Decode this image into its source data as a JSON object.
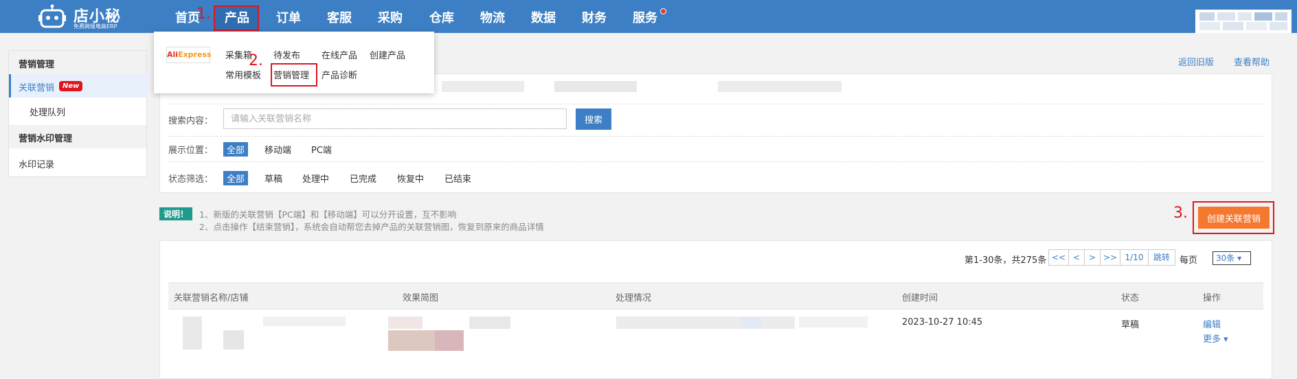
{
  "header": {
    "brand_name": "店小秘",
    "slogan": "免费跨境电商ERP",
    "nav": [
      {
        "label": "首页"
      },
      {
        "label": "产品"
      },
      {
        "label": "订单"
      },
      {
        "label": "客服"
      },
      {
        "label": "采购"
      },
      {
        "label": "仓库"
      },
      {
        "label": "物流"
      },
      {
        "label": "数据"
      },
      {
        "label": "财务"
      },
      {
        "label": "服务"
      }
    ],
    "active_nav": "产品"
  },
  "annotations": {
    "step1": "1.",
    "step2": "2.",
    "step3": "3."
  },
  "product_menu": {
    "platform_logo_left": "Ali",
    "platform_logo_right": "Express",
    "items": [
      "采集箱",
      "待发布",
      "在线产品",
      "创建产品",
      "常用模板",
      "营销管理",
      "产品诊断"
    ]
  },
  "sidebar": {
    "sections": [
      {
        "title": "营销管理",
        "items": [
          {
            "label": "关联营销",
            "badge": "New"
          },
          {
            "label": "处理队列"
          }
        ]
      },
      {
        "title": "营销水印管理",
        "items": [
          {
            "label": "水印记录"
          }
        ]
      }
    ]
  },
  "top_links": {
    "back_old": "返回旧版",
    "help": "查看帮助"
  },
  "filters": {
    "search_label": "搜索内容：",
    "search_placeholder": "请输入关联营销名称",
    "search_button": "搜索",
    "position_label": "展示位置：",
    "position_options": [
      "全部",
      "移动端",
      "PC端"
    ],
    "status_label": "状态筛选：",
    "status_options": [
      "全部",
      "草稿",
      "处理中",
      "已完成",
      "恢复中",
      "已结束"
    ]
  },
  "notice": {
    "badge": "说明！",
    "line1": "1、新版的关联营销【PC端】和【移动端】可以分开设置，互不影响",
    "line2": "2、点击操作【结束营销】，系统会自动帮您去掉产品的关联营销图，恢复到原来的商品详情"
  },
  "create_button": "创建关联营销",
  "pagination": {
    "summary": "第1-30条，共275条",
    "first": "<<",
    "prev": "<",
    "next": ">",
    "last": ">>",
    "page": "1/10",
    "jump": "跳转",
    "per_page_label": "每页",
    "per_page_value": "30条 ▾"
  },
  "table": {
    "columns": [
      "关联营销名称/店铺",
      "效果简图",
      "处理情况",
      "创建时间",
      "状态",
      "操作"
    ],
    "rows": [
      {
        "created": "2023-10-27 10:45",
        "status": "草稿",
        "edit": "编辑",
        "more": "更多 ▾"
      }
    ]
  }
}
